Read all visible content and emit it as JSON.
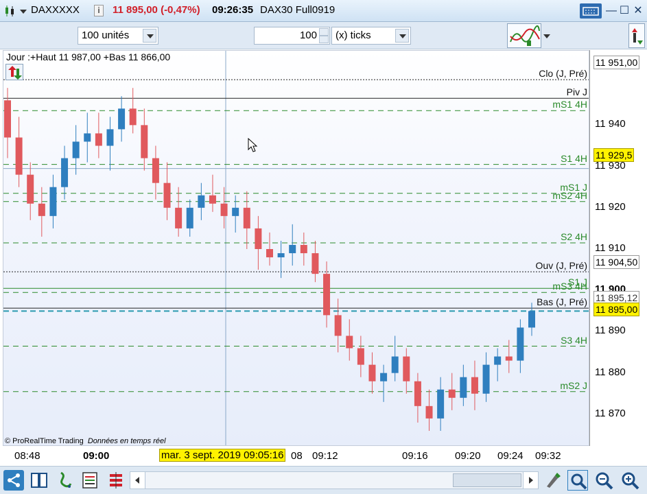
{
  "window": {
    "symbol": "DAXXXXX",
    "price_change": "11 895,00 (-0,47%)",
    "time": "09:26:35",
    "instrument": "DAX30 Full0919"
  },
  "toolbar": {
    "units_value": "100 unités",
    "ticks_value": "100",
    "ticks_unit": "(x) ticks"
  },
  "chart": {
    "info_line": "Jour :+Haut 11 987,00 +Bas 11 866,00",
    "copyright": "© ProRealTime Trading",
    "realtime_note": "Données en temps réel",
    "colors": {
      "up": "#2f7fbf",
      "down": "#e0595d",
      "green_level": "#2a8a2a"
    },
    "levels": [
      {
        "label": "Clo (J, Pré)",
        "price": 11951,
        "style": "black-dotted"
      },
      {
        "label": "Piv J",
        "price": 11946.5,
        "style": "black-solid"
      },
      {
        "label": "mS1 4H",
        "price": 11943.5,
        "style": "green-dashed"
      },
      {
        "label": "S1 4H",
        "price": 11930.5,
        "style": "green-dashed"
      },
      {
        "label": "mS1 J",
        "price": 11923.5,
        "style": "green-dashed"
      },
      {
        "label": "mS2 4H",
        "price": 11921.5,
        "style": "green-dashed"
      },
      {
        "label": "S2 4H",
        "price": 11911.5,
        "style": "green-dashed"
      },
      {
        "label": "Ouv (J, Pré)",
        "price": 11904.5,
        "style": "black-dotted"
      },
      {
        "label": "S1 J",
        "price": 11900.5,
        "style": "green-solid"
      },
      {
        "label": "mS3 4H",
        "price": 11899.5,
        "style": "green-dashed"
      },
      {
        "label": "Bas (J, Pré)",
        "price": 11895.7,
        "style": "black-solid"
      },
      {
        "label": "S3 4H",
        "price": 11886.5,
        "style": "green-dashed"
      },
      {
        "label": "mS2 J",
        "price": 11875.5,
        "style": "green-dashed"
      }
    ]
  },
  "yaxis": {
    "ticks": [
      "11 940",
      "11 930",
      "11 920",
      "11 910",
      "11 900",
      "11 890",
      "11 880",
      "11 870"
    ],
    "tick_values": [
      11940,
      11930,
      11920,
      11910,
      11900,
      11890,
      11880,
      11870
    ],
    "box_clo": "11 951,00",
    "box_cursor": "11 929,5",
    "box_ouv": "11 904,50",
    "box_bas": "11 895,12",
    "box_last": "11 895,00"
  },
  "xaxis": {
    "ticks": [
      "08:48",
      "09:00",
      "08",
      "09:12",
      "09:16",
      "09:20",
      "09:24",
      "09:32"
    ],
    "tick_values": [
      "08:48",
      "09:00",
      "09:08",
      "09:12",
      "09:16",
      "09:20",
      "09:24",
      "09:32"
    ],
    "cursor_date": "mar. 3 sept. 2019 09:05:16"
  },
  "chart_data": {
    "type": "candlestick",
    "ylim": [
      11864,
      11957
    ],
    "candles": [
      [
        11946,
        11949,
        11932,
        11937
      ],
      [
        11937,
        11942,
        11925,
        11928
      ],
      [
        11928,
        11931,
        11917,
        11921
      ],
      [
        11921,
        11925,
        11913,
        11918
      ],
      [
        11918,
        11928,
        11915,
        11925
      ],
      [
        11925,
        11935,
        11922,
        11932
      ],
      [
        11932,
        11940,
        11928,
        11936
      ],
      [
        11936,
        11943,
        11931,
        11938
      ],
      [
        11938,
        11943,
        11932,
        11935
      ],
      [
        11935,
        11942,
        11929,
        11939
      ],
      [
        11939,
        11947,
        11936,
        11944
      ],
      [
        11944,
        11949,
        11938,
        11940
      ],
      [
        11940,
        11944,
        11929,
        11932
      ],
      [
        11932,
        11935,
        11922,
        11926
      ],
      [
        11926,
        11931,
        11917,
        11920
      ],
      [
        11920,
        11925,
        11913,
        11915
      ],
      [
        11915,
        11922,
        11913,
        11920
      ],
      [
        11920,
        11926,
        11917,
        11923
      ],
      [
        11923,
        11928,
        11919,
        11921
      ],
      [
        11921,
        11925,
        11915,
        11918
      ],
      [
        11918,
        11923,
        11914,
        11920
      ],
      [
        11920,
        11924,
        11910,
        11915
      ],
      [
        11915,
        11918,
        11905,
        11910
      ],
      [
        11910,
        11914,
        11906,
        11908
      ],
      [
        11908,
        11912,
        11903,
        11909
      ],
      [
        11909,
        11916,
        11906,
        11911
      ],
      [
        11911,
        11914,
        11906,
        11909
      ],
      [
        11909,
        11912,
        11902,
        11904
      ],
      [
        11904,
        11907,
        11891,
        11894
      ],
      [
        11894,
        11898,
        11885,
        11889
      ],
      [
        11889,
        11893,
        11883,
        11886
      ],
      [
        11886,
        11889,
        11879,
        11882
      ],
      [
        11882,
        11885,
        11875,
        11878
      ],
      [
        11878,
        11882,
        11873,
        11880
      ],
      [
        11880,
        11889,
        11878,
        11884
      ],
      [
        11884,
        11886,
        11875,
        11878
      ],
      [
        11878,
        11880,
        11868,
        11872
      ],
      [
        11872,
        11876,
        11866,
        11869
      ],
      [
        11869,
        11879,
        11866,
        11876
      ],
      [
        11876,
        11880,
        11871,
        11874
      ],
      [
        11874,
        11882,
        11872,
        11879
      ],
      [
        11879,
        11883,
        11871,
        11875
      ],
      [
        11875,
        11885,
        11873,
        11882
      ],
      [
        11882,
        11886,
        11878,
        11884
      ],
      [
        11884,
        11888,
        11880,
        11883
      ],
      [
        11883,
        11893,
        11880,
        11891
      ],
      [
        11891,
        11897,
        11889,
        11895
      ]
    ]
  }
}
